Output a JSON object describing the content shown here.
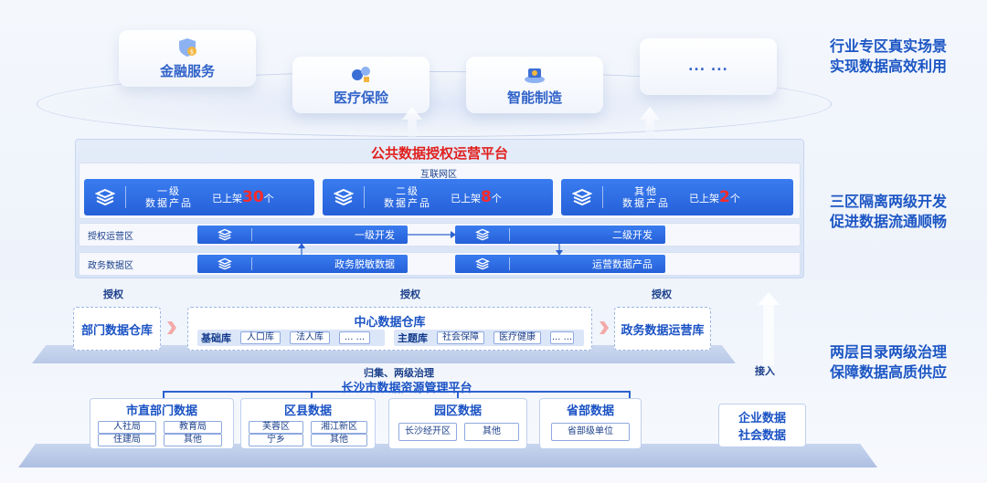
{
  "scenarios": [
    {
      "label": "金融服务",
      "icon": "finance-shield-icon"
    },
    {
      "label": "医疗保险",
      "icon": "medical-icon"
    },
    {
      "label": "智能制造",
      "icon": "factory-icon"
    },
    {
      "label": "... ...",
      "icon": ""
    }
  ],
  "side_captions": [
    {
      "line1": "行业专区真实场景",
      "line2": "实现数据高效利用"
    },
    {
      "line1": "三区隔离两级开发",
      "line2": "促进数据流通顺畅"
    },
    {
      "line1": "两层目录两级治理",
      "line2": "保障数据高质供应"
    }
  ],
  "platform": {
    "title": "公共数据授权运营平台",
    "internet_zone": "互联网区",
    "auth_zone": "授权运营区",
    "gov_zone": "政务数据区",
    "products": [
      {
        "line1": "一级",
        "line2": "数据产品",
        "shelf": "已上架",
        "count": "30",
        "unit": "个"
      },
      {
        "line1": "二级",
        "line2": "数据产品",
        "shelf": "已上架",
        "count": "8",
        "unit": "个"
      },
      {
        "line1": "其他",
        "line2": "数据产品",
        "shelf": "已上架",
        "count": "2",
        "unit": "个"
      }
    ],
    "dev1": "一级开发",
    "dev2": "二级开发",
    "gov1": "政务脱敏数据",
    "gov2": "运营数据产品"
  },
  "auth_labels": [
    "授权",
    "授权",
    "授权"
  ],
  "warehouse": {
    "dept": "部门数据仓库",
    "center": "中心数据仓库",
    "base_lib": "基础库",
    "base_tags": [
      "人口库",
      "法人库",
      "... ..."
    ],
    "topic_lib": "主题库",
    "topic_tags": [
      "社会保障",
      "医疗健康",
      "... ..."
    ],
    "ops": "政务数据运营库"
  },
  "collect_label": "归集、两级治理",
  "access_label": "接入",
  "mgmt_platform": "长沙市数据资源管理平台",
  "sources": [
    {
      "title": "市直部门数据",
      "items": [
        "人社局",
        "教育局",
        "住建局",
        "其他"
      ]
    },
    {
      "title": "区县数据",
      "items": [
        "芙蓉区",
        "湘江新区",
        "宁乡",
        "其他"
      ]
    },
    {
      "title": "园区数据",
      "items": [
        "长沙经开区",
        "其他"
      ]
    },
    {
      "title": "省部数据",
      "items": [
        "省部级单位"
      ]
    }
  ],
  "enterprise": {
    "line1": "企业数据",
    "line2": "社会数据"
  },
  "colors": {
    "accent": "#2560d8",
    "title_red": "#e0201e",
    "count_red": "#ff2a2a",
    "caption_blue": "#1c56c4"
  }
}
